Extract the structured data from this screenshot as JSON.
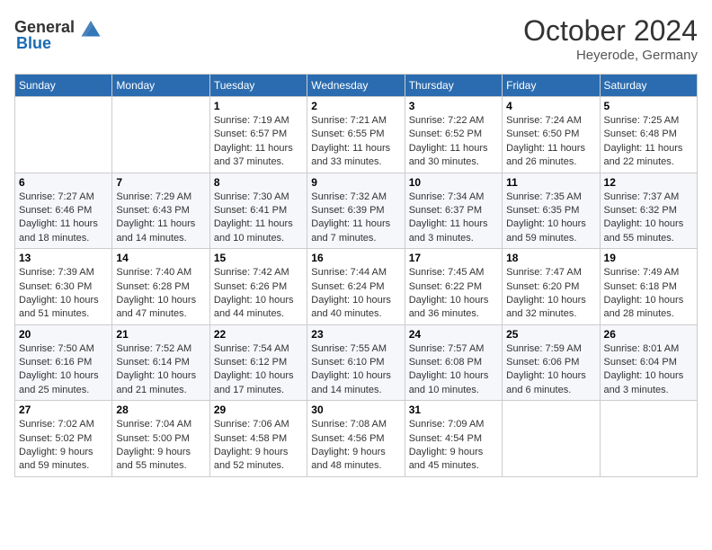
{
  "header": {
    "logo_general": "General",
    "logo_blue": "Blue",
    "month_year": "October 2024",
    "location": "Heyerode, Germany"
  },
  "weekdays": [
    "Sunday",
    "Monday",
    "Tuesday",
    "Wednesday",
    "Thursday",
    "Friday",
    "Saturday"
  ],
  "weeks": [
    [
      {
        "day": "",
        "sunrise": "",
        "sunset": "",
        "daylight": ""
      },
      {
        "day": "",
        "sunrise": "",
        "sunset": "",
        "daylight": ""
      },
      {
        "day": "1",
        "sunrise": "Sunrise: 7:19 AM",
        "sunset": "Sunset: 6:57 PM",
        "daylight": "Daylight: 11 hours and 37 minutes."
      },
      {
        "day": "2",
        "sunrise": "Sunrise: 7:21 AM",
        "sunset": "Sunset: 6:55 PM",
        "daylight": "Daylight: 11 hours and 33 minutes."
      },
      {
        "day": "3",
        "sunrise": "Sunrise: 7:22 AM",
        "sunset": "Sunset: 6:52 PM",
        "daylight": "Daylight: 11 hours and 30 minutes."
      },
      {
        "day": "4",
        "sunrise": "Sunrise: 7:24 AM",
        "sunset": "Sunset: 6:50 PM",
        "daylight": "Daylight: 11 hours and 26 minutes."
      },
      {
        "day": "5",
        "sunrise": "Sunrise: 7:25 AM",
        "sunset": "Sunset: 6:48 PM",
        "daylight": "Daylight: 11 hours and 22 minutes."
      }
    ],
    [
      {
        "day": "6",
        "sunrise": "Sunrise: 7:27 AM",
        "sunset": "Sunset: 6:46 PM",
        "daylight": "Daylight: 11 hours and 18 minutes."
      },
      {
        "day": "7",
        "sunrise": "Sunrise: 7:29 AM",
        "sunset": "Sunset: 6:43 PM",
        "daylight": "Daylight: 11 hours and 14 minutes."
      },
      {
        "day": "8",
        "sunrise": "Sunrise: 7:30 AM",
        "sunset": "Sunset: 6:41 PM",
        "daylight": "Daylight: 11 hours and 10 minutes."
      },
      {
        "day": "9",
        "sunrise": "Sunrise: 7:32 AM",
        "sunset": "Sunset: 6:39 PM",
        "daylight": "Daylight: 11 hours and 7 minutes."
      },
      {
        "day": "10",
        "sunrise": "Sunrise: 7:34 AM",
        "sunset": "Sunset: 6:37 PM",
        "daylight": "Daylight: 11 hours and 3 minutes."
      },
      {
        "day": "11",
        "sunrise": "Sunrise: 7:35 AM",
        "sunset": "Sunset: 6:35 PM",
        "daylight": "Daylight: 10 hours and 59 minutes."
      },
      {
        "day": "12",
        "sunrise": "Sunrise: 7:37 AM",
        "sunset": "Sunset: 6:32 PM",
        "daylight": "Daylight: 10 hours and 55 minutes."
      }
    ],
    [
      {
        "day": "13",
        "sunrise": "Sunrise: 7:39 AM",
        "sunset": "Sunset: 6:30 PM",
        "daylight": "Daylight: 10 hours and 51 minutes."
      },
      {
        "day": "14",
        "sunrise": "Sunrise: 7:40 AM",
        "sunset": "Sunset: 6:28 PM",
        "daylight": "Daylight: 10 hours and 47 minutes."
      },
      {
        "day": "15",
        "sunrise": "Sunrise: 7:42 AM",
        "sunset": "Sunset: 6:26 PM",
        "daylight": "Daylight: 10 hours and 44 minutes."
      },
      {
        "day": "16",
        "sunrise": "Sunrise: 7:44 AM",
        "sunset": "Sunset: 6:24 PM",
        "daylight": "Daylight: 10 hours and 40 minutes."
      },
      {
        "day": "17",
        "sunrise": "Sunrise: 7:45 AM",
        "sunset": "Sunset: 6:22 PM",
        "daylight": "Daylight: 10 hours and 36 minutes."
      },
      {
        "day": "18",
        "sunrise": "Sunrise: 7:47 AM",
        "sunset": "Sunset: 6:20 PM",
        "daylight": "Daylight: 10 hours and 32 minutes."
      },
      {
        "day": "19",
        "sunrise": "Sunrise: 7:49 AM",
        "sunset": "Sunset: 6:18 PM",
        "daylight": "Daylight: 10 hours and 28 minutes."
      }
    ],
    [
      {
        "day": "20",
        "sunrise": "Sunrise: 7:50 AM",
        "sunset": "Sunset: 6:16 PM",
        "daylight": "Daylight: 10 hours and 25 minutes."
      },
      {
        "day": "21",
        "sunrise": "Sunrise: 7:52 AM",
        "sunset": "Sunset: 6:14 PM",
        "daylight": "Daylight: 10 hours and 21 minutes."
      },
      {
        "day": "22",
        "sunrise": "Sunrise: 7:54 AM",
        "sunset": "Sunset: 6:12 PM",
        "daylight": "Daylight: 10 hours and 17 minutes."
      },
      {
        "day": "23",
        "sunrise": "Sunrise: 7:55 AM",
        "sunset": "Sunset: 6:10 PM",
        "daylight": "Daylight: 10 hours and 14 minutes."
      },
      {
        "day": "24",
        "sunrise": "Sunrise: 7:57 AM",
        "sunset": "Sunset: 6:08 PM",
        "daylight": "Daylight: 10 hours and 10 minutes."
      },
      {
        "day": "25",
        "sunrise": "Sunrise: 7:59 AM",
        "sunset": "Sunset: 6:06 PM",
        "daylight": "Daylight: 10 hours and 6 minutes."
      },
      {
        "day": "26",
        "sunrise": "Sunrise: 8:01 AM",
        "sunset": "Sunset: 6:04 PM",
        "daylight": "Daylight: 10 hours and 3 minutes."
      }
    ],
    [
      {
        "day": "27",
        "sunrise": "Sunrise: 7:02 AM",
        "sunset": "Sunset: 5:02 PM",
        "daylight": "Daylight: 9 hours and 59 minutes."
      },
      {
        "day": "28",
        "sunrise": "Sunrise: 7:04 AM",
        "sunset": "Sunset: 5:00 PM",
        "daylight": "Daylight: 9 hours and 55 minutes."
      },
      {
        "day": "29",
        "sunrise": "Sunrise: 7:06 AM",
        "sunset": "Sunset: 4:58 PM",
        "daylight": "Daylight: 9 hours and 52 minutes."
      },
      {
        "day": "30",
        "sunrise": "Sunrise: 7:08 AM",
        "sunset": "Sunset: 4:56 PM",
        "daylight": "Daylight: 9 hours and 48 minutes."
      },
      {
        "day": "31",
        "sunrise": "Sunrise: 7:09 AM",
        "sunset": "Sunset: 4:54 PM",
        "daylight": "Daylight: 9 hours and 45 minutes."
      },
      {
        "day": "",
        "sunrise": "",
        "sunset": "",
        "daylight": ""
      },
      {
        "day": "",
        "sunrise": "",
        "sunset": "",
        "daylight": ""
      }
    ]
  ]
}
